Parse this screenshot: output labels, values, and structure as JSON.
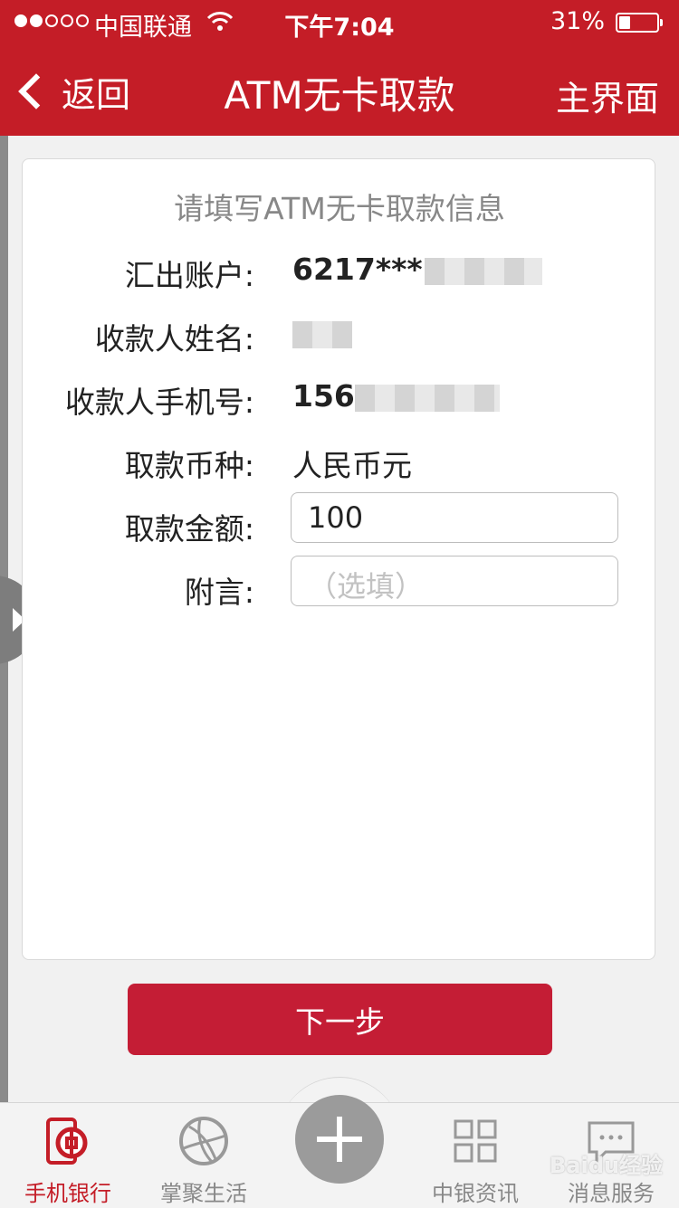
{
  "status_bar": {
    "carrier": "中国联通",
    "time": "下午7:04",
    "battery_percent": "31%",
    "battery_level": 0.31
  },
  "nav": {
    "back_label": "返回",
    "title": "ATM无卡取款",
    "home_label": "主界面"
  },
  "form": {
    "title": "请填写ATM无卡取款信息",
    "fields": [
      {
        "label": "汇出账户:",
        "value": "6217***"
      },
      {
        "label": "收款人姓名:",
        "value": ""
      },
      {
        "label": "收款人手机号:",
        "value": "156"
      },
      {
        "label": "取款币种:",
        "value": "人民币元"
      },
      {
        "label": "取款金额:",
        "value": "100"
      },
      {
        "label": "附言:",
        "placeholder": "（选填）"
      }
    ]
  },
  "next_button": "下一步",
  "tabbar": {
    "tabs": [
      {
        "label": "手机银行",
        "icon": "bank-logo-icon",
        "active": true
      },
      {
        "label": "掌聚生活",
        "icon": "globe-icon",
        "active": false
      },
      {
        "label": "",
        "icon": "plus-icon",
        "active": false
      },
      {
        "label": "中银资讯",
        "icon": "grid-icon",
        "active": false
      },
      {
        "label": "消息服务",
        "icon": "message-icon",
        "active": false
      }
    ]
  },
  "watermark": "Baidu经验",
  "colors": {
    "brand_red": "#c41d27",
    "button_red": "#c41d35"
  }
}
